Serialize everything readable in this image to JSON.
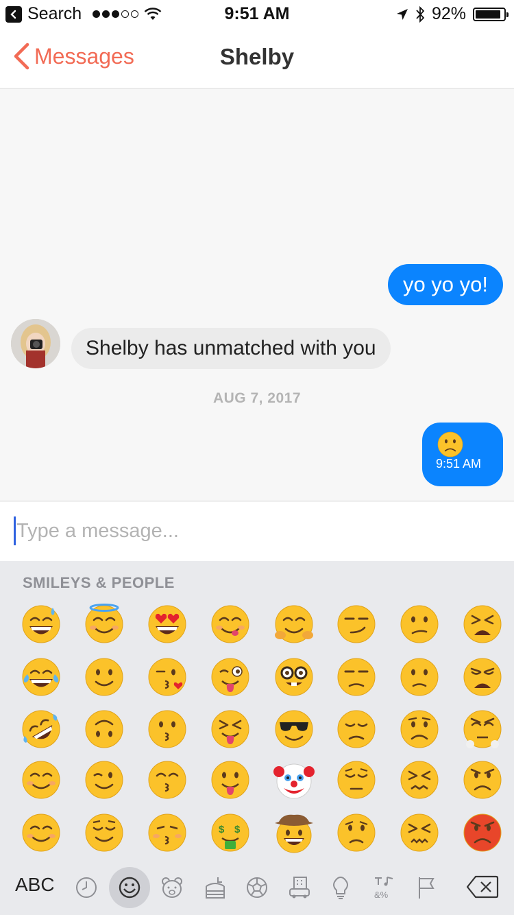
{
  "status_bar": {
    "back_app": "Search",
    "time": "9:51 AM",
    "battery": "92%",
    "battery_level": 0.92
  },
  "nav": {
    "back_label": "Messages",
    "title": "Shelby"
  },
  "conversation": {
    "outgoing_1": "yo yo yo!",
    "incoming_1": "Shelby has unmatched with you",
    "date_separator": "AUG 7, 2017",
    "outgoing_2_emoji": "frowning-face",
    "outgoing_2_time": "9:51 AM"
  },
  "input": {
    "placeholder": "Type a message...",
    "value": ""
  },
  "keyboard": {
    "category_title": "SMILEYS & PEOPLE",
    "abc_label": "ABC",
    "emoji_rows": [
      [
        "grinning-sweat",
        "smiling-halo",
        "heart-eyes",
        "yum",
        "hugging",
        "smirk",
        "confused",
        "tired"
      ],
      [
        "joy-tears",
        "slight-smile",
        "kissing-heart",
        "wink-tongue",
        "nerd",
        "unamused",
        "slight-frown",
        "weary"
      ],
      [
        "rofl",
        "upside-down",
        "kissing",
        "squint-tongue",
        "sunglasses",
        "disappointed",
        "frowning",
        "triumph"
      ],
      [
        "blush",
        "wink",
        "kissing-smiling-eyes",
        "tongue",
        "clown",
        "pensive",
        "confounded",
        "angry"
      ],
      [
        "smiling-blush",
        "relieved",
        "kissing-closed-eyes",
        "money-mouth",
        "cowboy",
        "worried",
        "persevere",
        "rage"
      ]
    ],
    "categories": [
      "recent-icon",
      "smileys-icon",
      "animals-icon",
      "food-icon",
      "activity-icon",
      "travel-icon",
      "objects-icon",
      "symbols-icon",
      "flags-icon"
    ],
    "active_category": "smileys-icon"
  },
  "colors": {
    "accent": "#f26b55",
    "outgoing_bubble": "#0b84fe",
    "incoming_bubble": "#ebebeb",
    "emoji_yellow": "#fbc22a",
    "emoji_angry": "#e8462a"
  }
}
